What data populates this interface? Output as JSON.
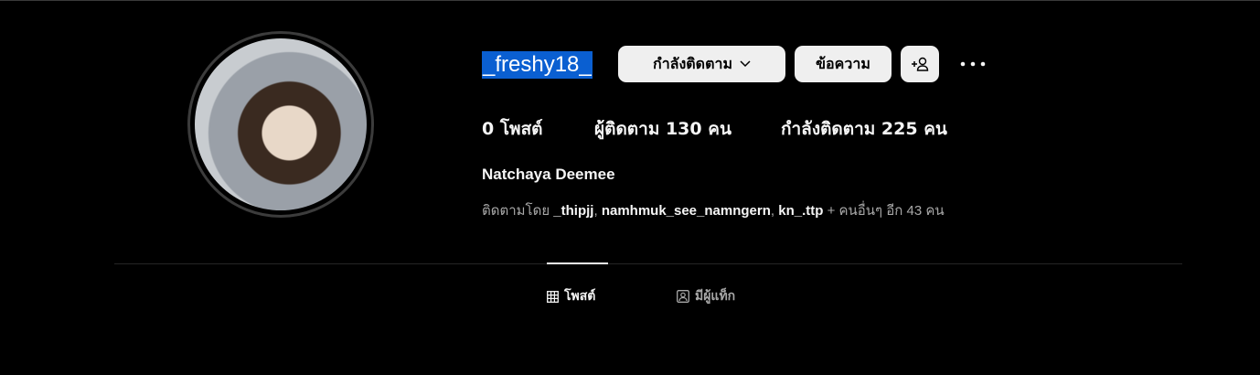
{
  "profile": {
    "username": "_freshy18_",
    "full_name": "Natchaya Deemee",
    "following_button": "กำลังติดตาม",
    "message_button": "ข้อความ",
    "stats": {
      "posts": "0 โพสต์",
      "followers": "ผู้ติดตาม 130 คน",
      "following": "กำลังติดตาม 225 คน"
    },
    "followed_by": {
      "prefix": "ติดตามโดย",
      "users": [
        "_thipjj",
        "namhmuk_see_namngern",
        "kn_.ttp"
      ],
      "suffix": "+ คนอื่นๆ อีก 43 คน"
    }
  },
  "tabs": [
    {
      "label": "โพสต์",
      "icon": "grid-icon",
      "active": true
    },
    {
      "label": "มีผู้แท็ก",
      "icon": "tagged-user-icon",
      "active": false
    }
  ],
  "colors": {
    "selection": "#0a5fd1",
    "button_bg": "#efefef",
    "muted": "#a8a8a8"
  }
}
